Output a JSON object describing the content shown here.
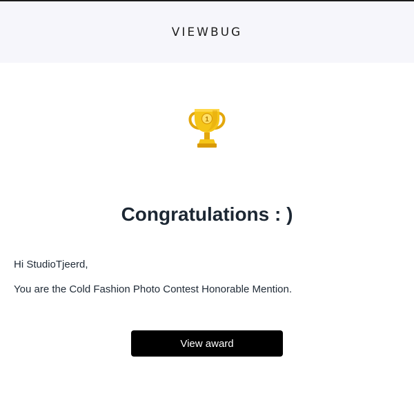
{
  "header": {
    "logo_text": "VIEWBUG"
  },
  "trophy": {
    "icon": "trophy-icon",
    "rank_text": "1",
    "colors": {
      "gold": "#f5c518",
      "gold_dark": "#d99a06",
      "gold_light": "#ffe066"
    }
  },
  "main": {
    "title": "Congratulations : )",
    "greeting": "Hi StudioTjeerd,",
    "message": "You are the Cold Fashion Photo Contest Honorable Mention.",
    "cta_label": "View award"
  },
  "colors": {
    "header_bg": "#f6f6fb",
    "button_bg": "#000000",
    "text": "#1f2a36"
  }
}
